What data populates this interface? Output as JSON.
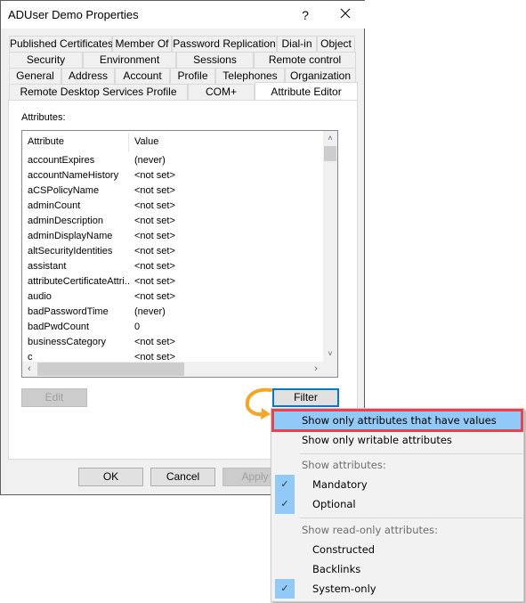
{
  "window": {
    "title": "ADUser Demo Properties",
    "help_label": "?",
    "close_label": "✕"
  },
  "tabs": {
    "row1": [
      {
        "label": "Published Certificates"
      },
      {
        "label": "Member Of"
      },
      {
        "label": "Password Replication"
      },
      {
        "label": "Dial-in"
      },
      {
        "label": "Object"
      }
    ],
    "row2": [
      {
        "label": "Security"
      },
      {
        "label": "Environment"
      },
      {
        "label": "Sessions"
      },
      {
        "label": "Remote control"
      }
    ],
    "row3": [
      {
        "label": "General"
      },
      {
        "label": "Address"
      },
      {
        "label": "Account"
      },
      {
        "label": "Profile"
      },
      {
        "label": "Telephones"
      },
      {
        "label": "Organization"
      }
    ],
    "row4": [
      {
        "label": "Remote Desktop Services Profile"
      },
      {
        "label": "COM+"
      },
      {
        "label": "Attribute Editor",
        "active": true
      }
    ]
  },
  "attributes": {
    "label": "Attributes:",
    "columns": [
      "Attribute",
      "Value"
    ],
    "rows": [
      {
        "name": "accountExpires",
        "value": "(never)"
      },
      {
        "name": "accountNameHistory",
        "value": "<not set>"
      },
      {
        "name": "aCSPolicyName",
        "value": "<not set>"
      },
      {
        "name": "adminCount",
        "value": "<not set>"
      },
      {
        "name": "adminDescription",
        "value": "<not set>"
      },
      {
        "name": "adminDisplayName",
        "value": "<not set>"
      },
      {
        "name": "altSecurityIdentities",
        "value": "<not set>"
      },
      {
        "name": "assistant",
        "value": "<not set>"
      },
      {
        "name": "attributeCertificateAttri...",
        "value": "<not set>"
      },
      {
        "name": "audio",
        "value": "<not set>"
      },
      {
        "name": "badPasswordTime",
        "value": "(never)"
      },
      {
        "name": "badPwdCount",
        "value": "0"
      },
      {
        "name": "businessCategory",
        "value": "<not set>"
      },
      {
        "name": "c",
        "value": "<not set>"
      }
    ]
  },
  "buttons": {
    "edit": "Edit",
    "filter": "Filter",
    "ok": "OK",
    "cancel": "Cancel",
    "apply": "Apply"
  },
  "filter_menu": {
    "items": [
      {
        "label": "Show only attributes that have values",
        "highlighted": true
      },
      {
        "label": "Show only writable attributes"
      }
    ],
    "show_attributes_header": "Show attributes:",
    "show_attributes": [
      {
        "label": "Mandatory",
        "checked": true
      },
      {
        "label": "Optional",
        "checked": true
      }
    ],
    "read_only_header": "Show read-only attributes:",
    "read_only": [
      {
        "label": "Constructed",
        "checked": false
      },
      {
        "label": "Backlinks",
        "checked": false
      },
      {
        "label": "System-only",
        "checked": true
      }
    ]
  },
  "annotation": {
    "arrow_color": "#f5a623",
    "highlight_color": "#e8434f"
  }
}
